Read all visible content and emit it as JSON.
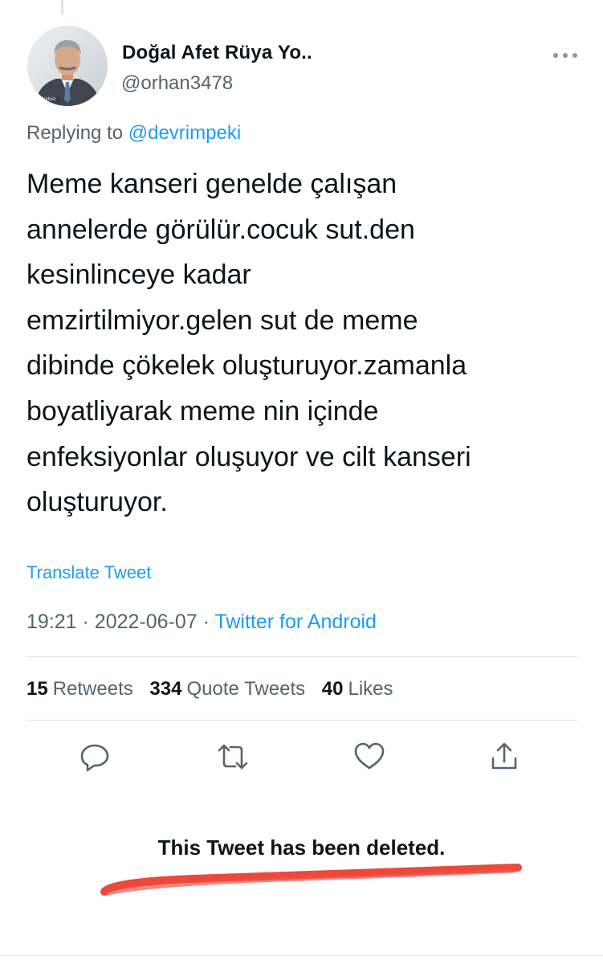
{
  "header": {
    "display_name": "Doğal Afet Rüya Yo..",
    "handle": "@orhan3478",
    "avatar_caption": "Gürbüz",
    "more_icon": "more-horizontal-icon"
  },
  "reply": {
    "prefix": "Replying to",
    "mention": "@devrimpeki"
  },
  "tweet": {
    "lines": [
      "Meme kanseri genelde çalışan",
      "annelerde görülür.cocuk sut.den",
      "kesinlinceye kadar",
      "emzirtilmiyor.gelen sut de meme",
      "dibinde çökelek oluşturuyor.zamanla",
      "boyatliyarak meme nin içinde",
      "enfeksiyonlar oluşuyor ve cilt kanseri",
      "oluşturuyor."
    ],
    "translate_label": "Translate Tweet",
    "time": "19:21",
    "date": "2022-06-07",
    "separator": "·",
    "source": "Twitter for Android"
  },
  "stats": {
    "retweets": {
      "count": "15",
      "label": "Retweets"
    },
    "quotes": {
      "count": "334",
      "label": "Quote Tweets"
    },
    "likes": {
      "count": "40",
      "label": "Likes"
    }
  },
  "actions": [
    {
      "name": "reply-icon"
    },
    {
      "name": "retweet-icon"
    },
    {
      "name": "like-icon"
    },
    {
      "name": "share-icon"
    }
  ],
  "deleted_notice": "This Tweet has been deleted.",
  "colors": {
    "text": "#0f1419",
    "secondary": "#536471",
    "accent": "#1d9bf0",
    "underline": "#e8392b"
  }
}
